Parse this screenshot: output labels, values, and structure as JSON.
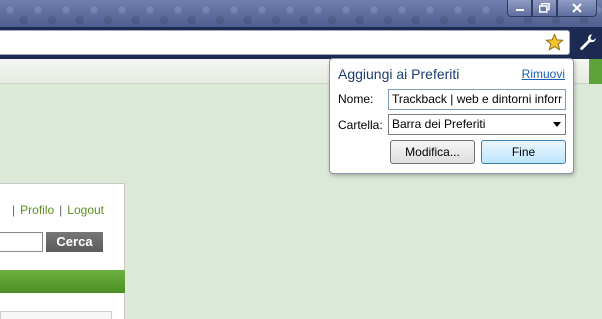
{
  "window": {
    "controls": [
      "minimize-icon",
      "restore-icon",
      "close-icon"
    ]
  },
  "toolbar": {
    "bookmark_star_icon": "star-icon",
    "menu_icon": "wrench-icon",
    "colors": {
      "toolbar": "#1d2a52",
      "star": "#f2c230"
    }
  },
  "page": {
    "user_links": [
      "Profilo",
      "Logout"
    ],
    "link_separator": "|",
    "search_button": "Cerca",
    "accent_color": "#5ea33a"
  },
  "bookmark_bubble": {
    "title": "Aggiungi ai Preferiti",
    "remove_link": "Rimuovi",
    "name_label": "Nome:",
    "name_value": "Trackback | web e dintorni inforr",
    "folder_label": "Cartella:",
    "folder_selected": "Barra dei Preferiti",
    "edit_button": "Modifica...",
    "done_button": "Fine"
  }
}
